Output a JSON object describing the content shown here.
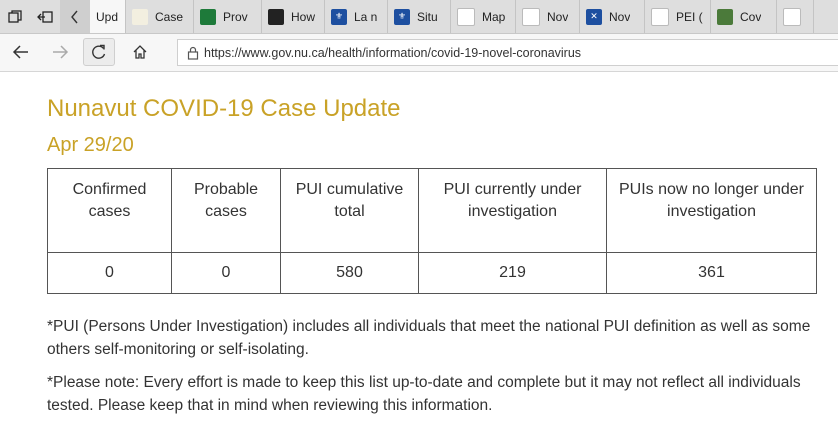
{
  "browser": {
    "tabs": [
      {
        "title": "Upd",
        "favicon": "page-icon",
        "color": "#ffffff",
        "glyph": "",
        "active": true
      },
      {
        "title": "Case",
        "favicon": "leaf-icon",
        "color": "#f3efe0",
        "glyph": "",
        "active": false
      },
      {
        "title": "Prov",
        "favicon": "green-banner-icon",
        "color": "#1e7a3a",
        "glyph": "",
        "active": false
      },
      {
        "title": "How",
        "favicon": "trillium-icon",
        "color": "#222222",
        "glyph": "",
        "active": false
      },
      {
        "title": "La n",
        "favicon": "quebec-fleur-icon",
        "color": "#1d4fa0",
        "glyph": "⚜",
        "active": false
      },
      {
        "title": "Situ",
        "favicon": "quebec-fleur-icon",
        "color": "#1d4fa0",
        "glyph": "⚜",
        "active": false
      },
      {
        "title": "Map",
        "favicon": "red-logo-icon",
        "color": "#ffffff",
        "glyph": "",
        "active": false
      },
      {
        "title": "Nov",
        "favicon": "crest-icon",
        "color": "#ffffff",
        "glyph": "",
        "active": false
      },
      {
        "title": "Nov",
        "favicon": "saltire-icon",
        "color": "#1d4fa0",
        "glyph": "✕",
        "active": false
      },
      {
        "title": "PEI (",
        "favicon": "pei-icon",
        "color": "#ffffff",
        "glyph": "",
        "active": false
      },
      {
        "title": "Cov",
        "favicon": "globe-icon",
        "color": "#4b7a3a",
        "glyph": "",
        "active": false
      },
      {
        "title": "",
        "favicon": "inuksuk-icon",
        "color": "#ffffff",
        "glyph": "",
        "active": false
      }
    ],
    "url": "https://www.gov.nu.ca/health/information/covid-19-novel-coronavirus"
  },
  "page": {
    "title": "Nunavut COVID-19 Case Update",
    "date": "Apr 29/20",
    "title_color": "#c9a227",
    "table": {
      "headers": [
        "Confirmed cases",
        "Probable cases",
        "PUI cumulative total",
        "PUI currently under investigation",
        "PUIs now no longer under investigation"
      ],
      "values": [
        "0",
        "0",
        "580",
        "219",
        "361"
      ]
    },
    "notes": [
      "*PUI (Persons Under Investigation) includes all individuals that meet the national PUI definition as well as some others self-monitoring or self-isolating.",
      "*Please note: Every effort is made to keep this list up-to-date and complete but it may not reflect all individuals tested. Please keep that in mind when reviewing this information."
    ]
  }
}
